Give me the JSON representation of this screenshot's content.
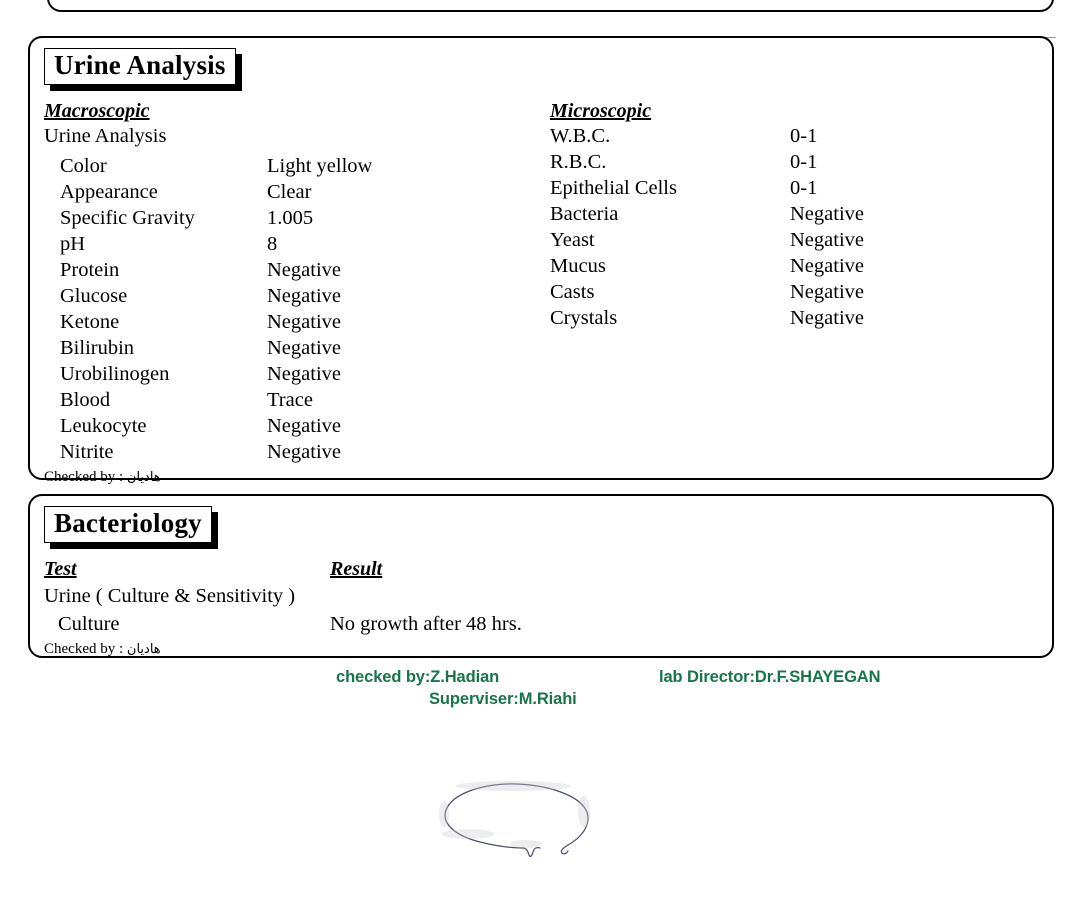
{
  "document": {
    "type": "laboratory-report",
    "accent_green": "#17754a",
    "ink_color": "#3c4257"
  },
  "urine_card": {
    "title": "Urine Analysis",
    "macroscopic": {
      "heading": "Macroscopic",
      "group_name": "Urine Analysis",
      "rows": [
        {
          "label": "Color",
          "value": "Light yellow"
        },
        {
          "label": "Appearance",
          "value": "Clear"
        },
        {
          "label": "Specific Gravity",
          "value": "1.005"
        },
        {
          "label": "pH",
          "value": "8"
        },
        {
          "label": "Protein",
          "value": "Negative"
        },
        {
          "label": "Glucose",
          "value": "Negative"
        },
        {
          "label": "Ketone",
          "value": "Negative"
        },
        {
          "label": "Bilirubin",
          "value": "Negative"
        },
        {
          "label": "Urobilinogen",
          "value": "Negative"
        },
        {
          "label": "Blood",
          "value": "Trace"
        },
        {
          "label": "Leukocyte",
          "value": "Negative"
        },
        {
          "label": "Nitrite",
          "value": "Negative"
        }
      ]
    },
    "microscopic": {
      "heading": "Microscopic",
      "rows": [
        {
          "label": "W.B.C.",
          "value": "0-1"
        },
        {
          "label": "R.B.C.",
          "value": "0-1"
        },
        {
          "label": "Epithelial Cells",
          "value": "0-1"
        },
        {
          "label": "Bacteria",
          "value": "Negative"
        },
        {
          "label": "Yeast",
          "value": "Negative"
        },
        {
          "label": "Mucus",
          "value": "Negative"
        },
        {
          "label": "Casts",
          "value": "Negative"
        },
        {
          "label": "Crystals",
          "value": "Negative"
        }
      ]
    },
    "checked_by_prefix": "Checked by : ",
    "checked_by_name": "هادیان"
  },
  "bacteriology_card": {
    "title": "Bacteriology",
    "headers": {
      "test": "Test",
      "result": "Result"
    },
    "group_name": "Urine ( Culture & Sensitivity )",
    "rows": [
      {
        "label": "Culture",
        "value": "No growth after  48   hrs."
      }
    ],
    "checked_by_prefix": "Checked by : ",
    "checked_by_name": "هادیان"
  },
  "footer": {
    "checked_by": "checked by:Z.Hadian",
    "lab_director": "lab Director:Dr.F.SHAYEGAN",
    "superviser": "Superviser:M.Riahi"
  }
}
